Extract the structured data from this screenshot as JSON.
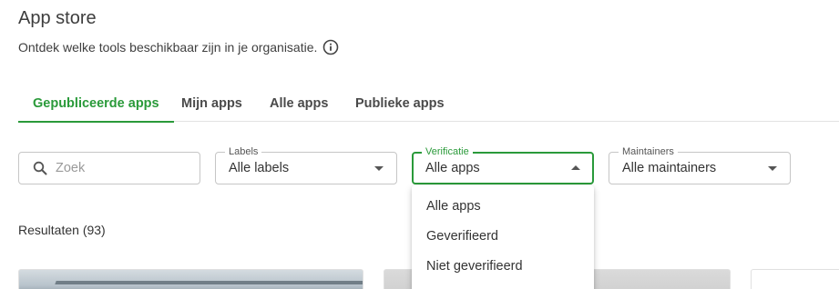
{
  "header": {
    "title": "App store",
    "subtitle": "Ontdek welke tools beschikbaar zijn in je organisatie."
  },
  "tabs": [
    {
      "label": "Gepubliceerde apps",
      "active": true
    },
    {
      "label": "Mijn apps",
      "active": false
    },
    {
      "label": "Alle apps",
      "active": false
    },
    {
      "label": "Publieke apps",
      "active": false
    }
  ],
  "filters": {
    "search": {
      "placeholder": "Zoek",
      "value": ""
    },
    "labels": {
      "label": "Labels",
      "value": "Alle labels"
    },
    "verificatie": {
      "label": "Verificatie",
      "value": "Alle apps",
      "open": true
    },
    "maintainers": {
      "label": "Maintainers",
      "value": "Alle maintainers"
    }
  },
  "dropdown": {
    "options": [
      "Alle apps",
      "Geverifieerd",
      "Niet geverifieerd"
    ]
  },
  "results": {
    "label": "Resultaten (93)"
  },
  "colors": {
    "accent": "#2a9a3a",
    "text": "#3c3c3c",
    "border": "#c6c6c6"
  },
  "icons": {
    "info": "info-icon",
    "search": "search-icon",
    "dropdown_closed": "caret-down-icon",
    "dropdown_open": "caret-up-icon"
  }
}
